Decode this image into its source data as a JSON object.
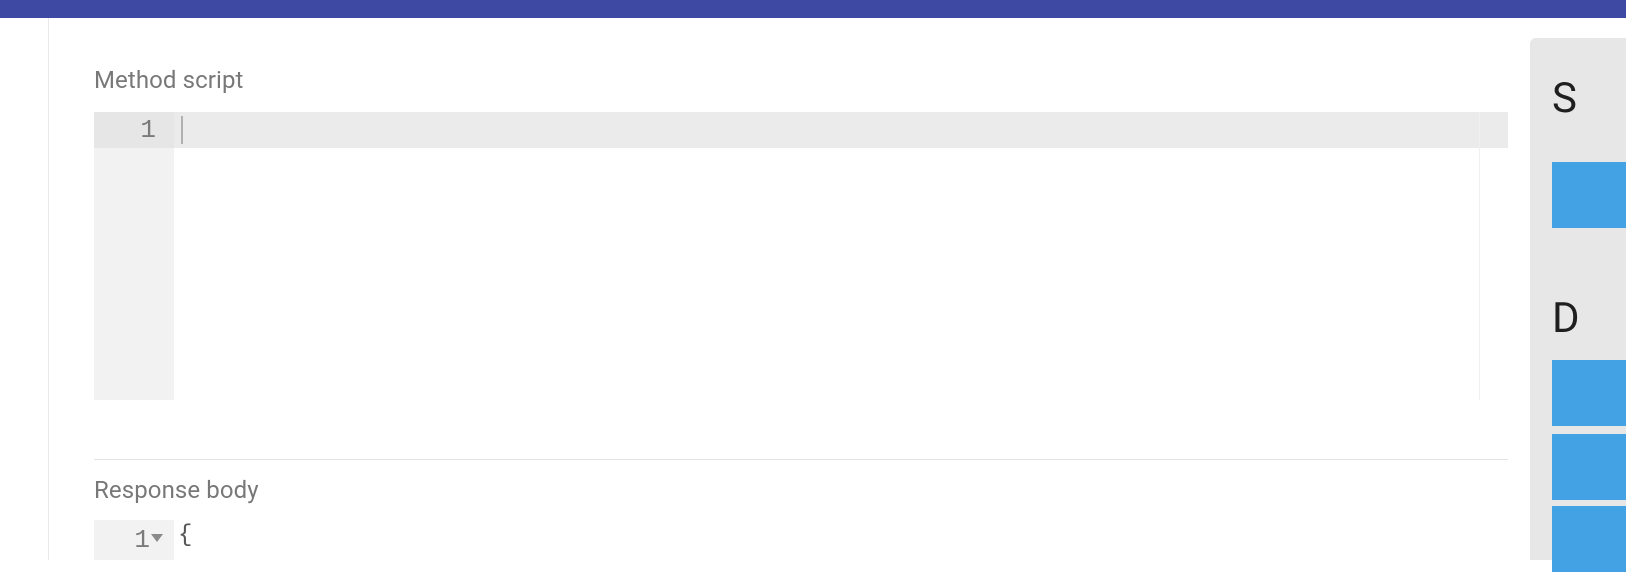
{
  "labels": {
    "method_script": "Method script",
    "response_body": "Response body"
  },
  "method_editor": {
    "line_number": "1",
    "content": ""
  },
  "response_editor": {
    "line_number": "1",
    "content": "{"
  },
  "side_panel": {
    "heading1": "S",
    "heading2": "D"
  }
}
